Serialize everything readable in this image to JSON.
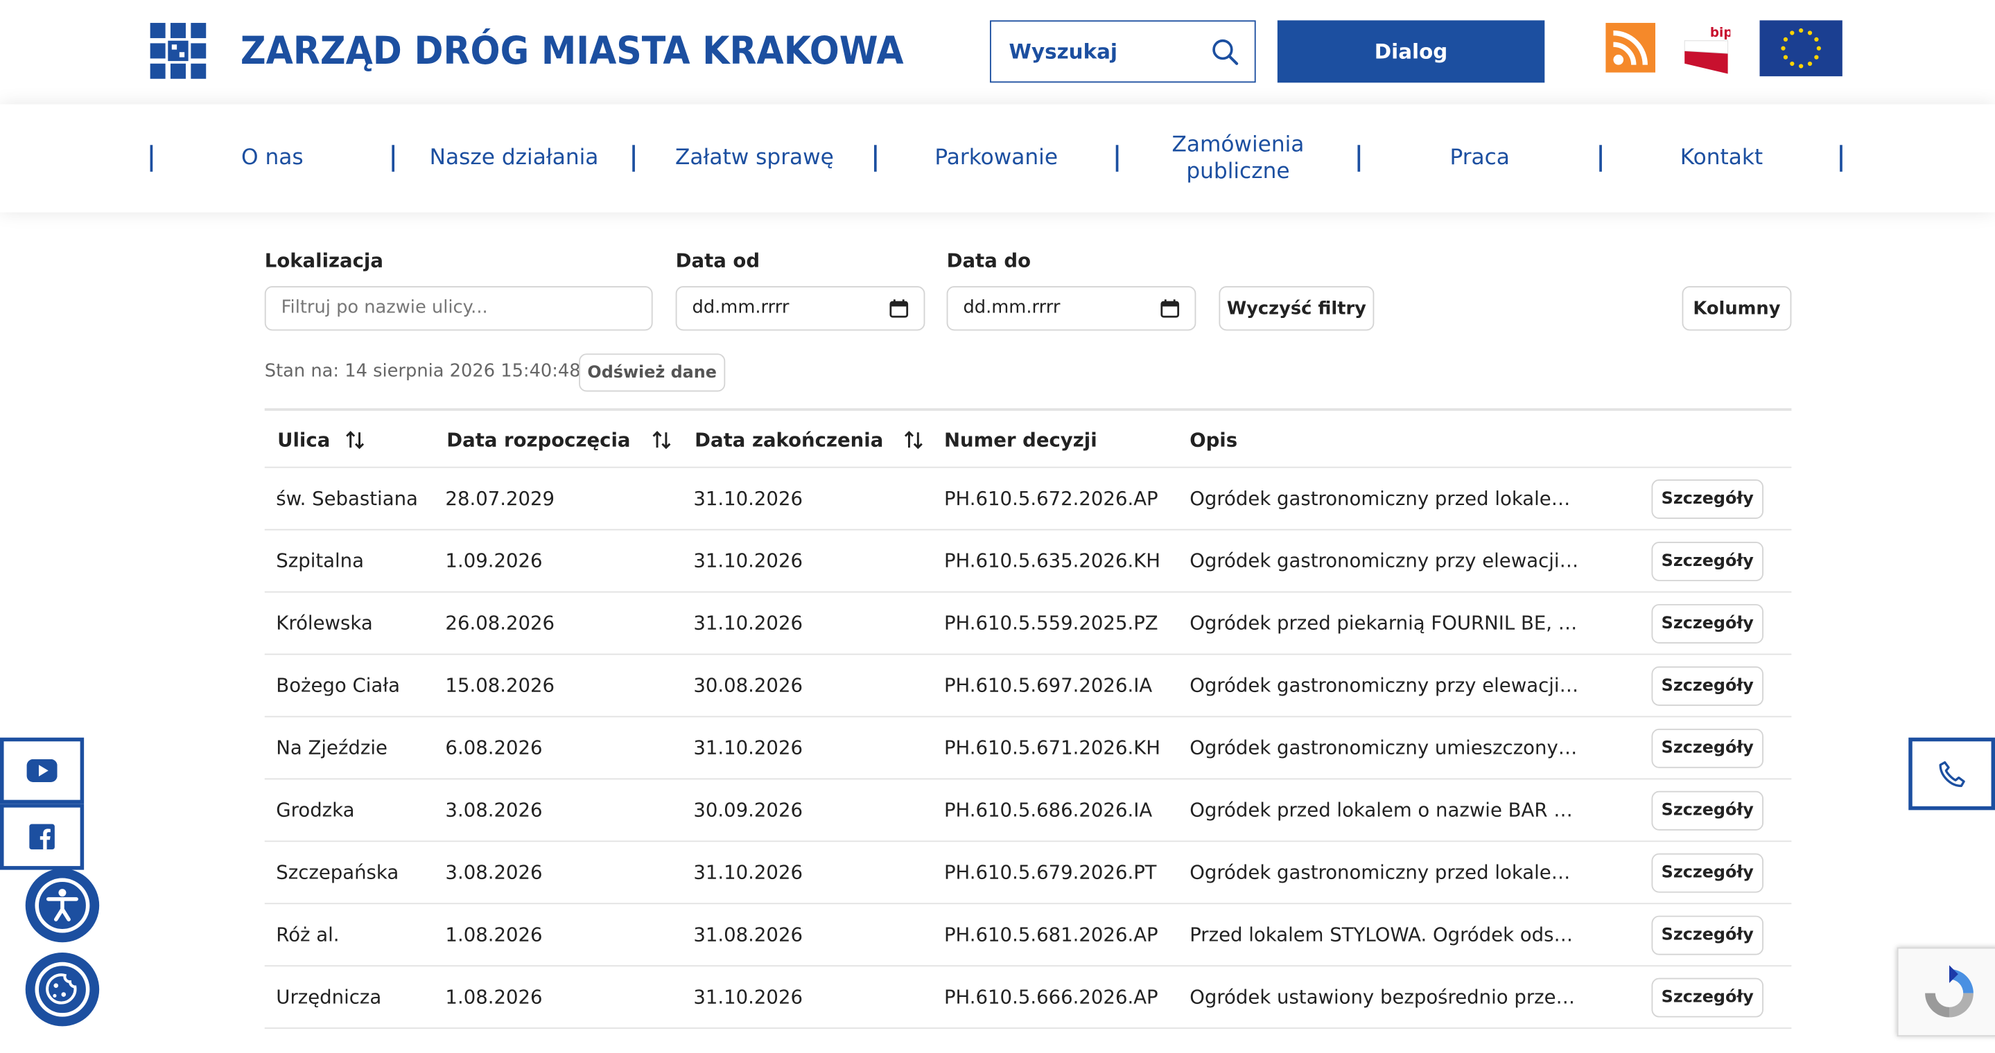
{
  "header": {
    "title": "ZARZĄD DRÓG MIASTA KRAKOWA",
    "search_placeholder": "Wyszukaj",
    "dialog_label": "Dialog",
    "bip_label": "bip"
  },
  "nav": {
    "items": [
      "O nas",
      "Nasze działania",
      "Załatw sprawę",
      "Parkowanie",
      "Zamówienia publiczne",
      "Praca",
      "Kontakt"
    ]
  },
  "filters": {
    "location_label": "Lokalizacja",
    "location_placeholder": "Filtruj po nazwie ulicy...",
    "date_from_label": "Data od",
    "date_from_value": "dd.mm.rrrr",
    "date_to_label": "Data do",
    "date_to_value": "dd.mm.rrrr",
    "clear_label": "Wyczyść filtry",
    "columns_label": "Kolumny"
  },
  "status": {
    "text": "Stan na: 14 sierpnia 2026 15:40:48",
    "refresh_label": "Odśwież dane"
  },
  "table": {
    "headers": [
      "Ulica",
      "Data rozpoczęcia",
      "Data zakończenia",
      "Numer decyzji",
      "Opis"
    ],
    "details_label": "Szczegóły",
    "rows": [
      [
        "św. Sebastiana",
        "28.07.2029",
        "31.10.2026",
        "PH.610.5.672.2026.AP",
        "Ogródek gastronomiczny przed lokalem \"..."
      ],
      [
        "Szpitalna",
        "1.09.2026",
        "31.10.2026",
        "PH.610.5.635.2026.KH",
        "Ogródek gastronomiczny przy elewacji, pr..."
      ],
      [
        "Królewska",
        "26.08.2026",
        "31.10.2026",
        "PH.610.5.559.2025.PZ",
        "Ogródek przed piekarnią FOURNIL BE, ust..."
      ],
      [
        "Bożego Ciała",
        "15.08.2026",
        "30.08.2026",
        "PH.610.5.697.2026.IA",
        "Ogródek gastronomiczny przy elewacji pr..."
      ],
      [
        "Na Zjeździe",
        "6.08.2026",
        "31.10.2026",
        "PH.610.5.671.2026.KH",
        "Ogródek gastronomiczny umieszczony od ..."
      ],
      [
        "Grodzka",
        "3.08.2026",
        "30.09.2026",
        "PH.610.5.686.2026.IA",
        "Ogródek przed lokalem o nazwie BAR PO..."
      ],
      [
        "Szczepańska",
        "3.08.2026",
        "31.10.2026",
        "PH.610.5.679.2026.PT",
        "Ogródek gastronomiczny przed lokalem \"..."
      ],
      [
        "Róż al.",
        "1.08.2026",
        "31.08.2026",
        "PH.610.5.681.2026.AP",
        "Przed lokalem STYLOWA. Ogródek odsuni..."
      ],
      [
        "Urzędnicza",
        "1.08.2026",
        "31.10.2026",
        "PH.610.5.666.2026.AP",
        "Ogródek ustawiony bezpośrednio przed e..."
      ]
    ]
  },
  "icons": {
    "search": "search-icon",
    "rss": "rss-icon",
    "eu": "eu-flag-icon",
    "youtube": "youtube-icon",
    "facebook": "facebook-icon",
    "accessibility": "accessibility-icon",
    "cookie": "cookie-icon",
    "phone": "phone-icon",
    "recaptcha": "recaptcha-icon"
  },
  "colors": {
    "brand": "#1c4fa0",
    "rss": "#f5892a",
    "eu": "#1b3f91",
    "bip_red": "#c8102e"
  }
}
